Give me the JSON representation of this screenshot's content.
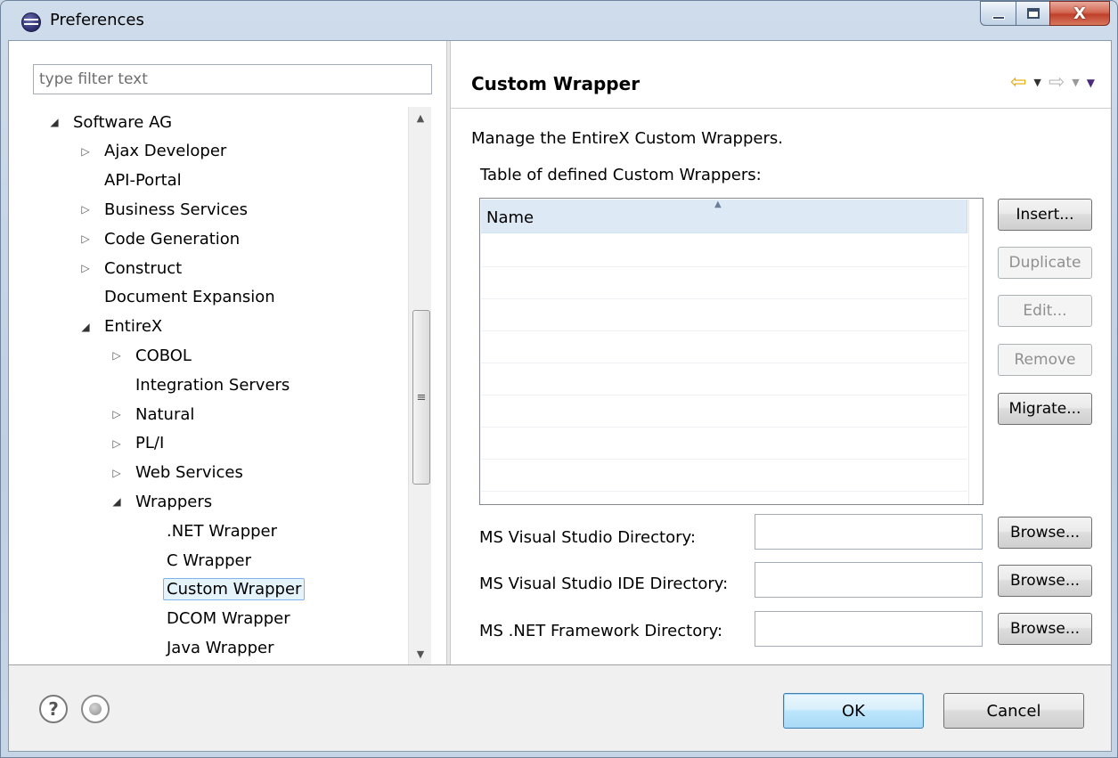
{
  "window": {
    "title": "Preferences",
    "close_glyph": "X"
  },
  "left": {
    "filter_placeholder": "type filter text",
    "tree": [
      {
        "label": "Software AG",
        "twisty": "open"
      },
      {
        "label": "Ajax Developer",
        "twisty": "closed"
      },
      {
        "label": "API-Portal",
        "twisty": "none"
      },
      {
        "label": "Business Services",
        "twisty": "closed"
      },
      {
        "label": "Code Generation",
        "twisty": "closed"
      },
      {
        "label": "Construct",
        "twisty": "closed"
      },
      {
        "label": "Document Expansion",
        "twisty": "none"
      },
      {
        "label": "EntireX",
        "twisty": "open"
      },
      {
        "label": "COBOL",
        "twisty": "closed"
      },
      {
        "label": "Integration Servers",
        "twisty": "none"
      },
      {
        "label": "Natural",
        "twisty": "closed"
      },
      {
        "label": "PL/I",
        "twisty": "closed"
      },
      {
        "label": "Web Services",
        "twisty": "closed"
      },
      {
        "label": "Wrappers",
        "twisty": "open"
      },
      {
        "label": ".NET Wrapper",
        "twisty": "none"
      },
      {
        "label": "C Wrapper",
        "twisty": "none"
      },
      {
        "label": "Custom Wrapper",
        "twisty": "none",
        "selected": true
      },
      {
        "label": "DCOM Wrapper",
        "twisty": "none"
      },
      {
        "label": "Java Wrapper",
        "twisty": "none"
      }
    ]
  },
  "page": {
    "title": "Custom Wrapper",
    "description": "Manage the EntireX Custom Wrappers.",
    "table_label": "Table of defined Custom Wrappers:",
    "table_header": "Name",
    "buttons": {
      "insert": "Insert...",
      "duplicate": "Duplicate",
      "edit": "Edit...",
      "remove": "Remove",
      "migrate": "Migrate..."
    },
    "directories": [
      {
        "label": "MS Visual Studio Directory:",
        "value": "",
        "browse": "Browse..."
      },
      {
        "label": "MS Visual Studio IDE Directory:",
        "value": "",
        "browse": "Browse..."
      },
      {
        "label": "MS .NET Framework Directory:",
        "value": "",
        "browse": "Browse..."
      }
    ]
  },
  "footer": {
    "ok": "OK",
    "cancel": "Cancel"
  },
  "icons": {
    "back": "back-arrow-icon",
    "forward": "forward-arrow-icon",
    "help": "help-icon",
    "record": "record-macro-icon"
  }
}
